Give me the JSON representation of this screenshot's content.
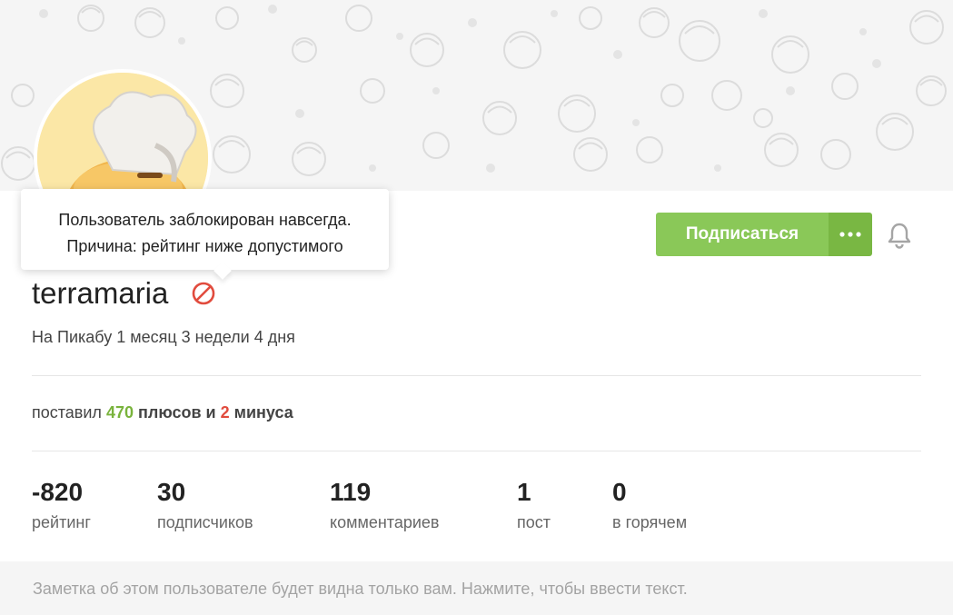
{
  "tooltip": {
    "line1": "Пользователь заблокирован навсегда.",
    "line2": "Причина: рейтинг ниже допустимого"
  },
  "profile": {
    "username": "terramaria",
    "since": "На Пикабу 1 месяц 3 недели 4 дня"
  },
  "votes": {
    "prefix": "поставил",
    "plus_count": "470",
    "plus_word": "плюсов и",
    "minus_count": "2",
    "minus_word": "минуса"
  },
  "stats": [
    {
      "value": "-820",
      "label": "рейтинг"
    },
    {
      "value": "30",
      "label": "подписчиков"
    },
    {
      "value": "119",
      "label": "комментариев"
    },
    {
      "value": "1",
      "label": "пост"
    },
    {
      "value": "0",
      "label": "в горячем"
    }
  ],
  "actions": {
    "subscribe_label": "Подписаться",
    "more_icon": "dots-horizontal-icon",
    "bell_icon": "bell-icon"
  },
  "note": {
    "placeholder": "Заметка об этом пользователе будет видна только вам. Нажмите, чтобы ввести текст."
  },
  "colors": {
    "accent_green": "#8ac858",
    "plus_green": "#79b33c",
    "minus_red": "#e14b3d",
    "ban_red": "#e14b3d"
  }
}
